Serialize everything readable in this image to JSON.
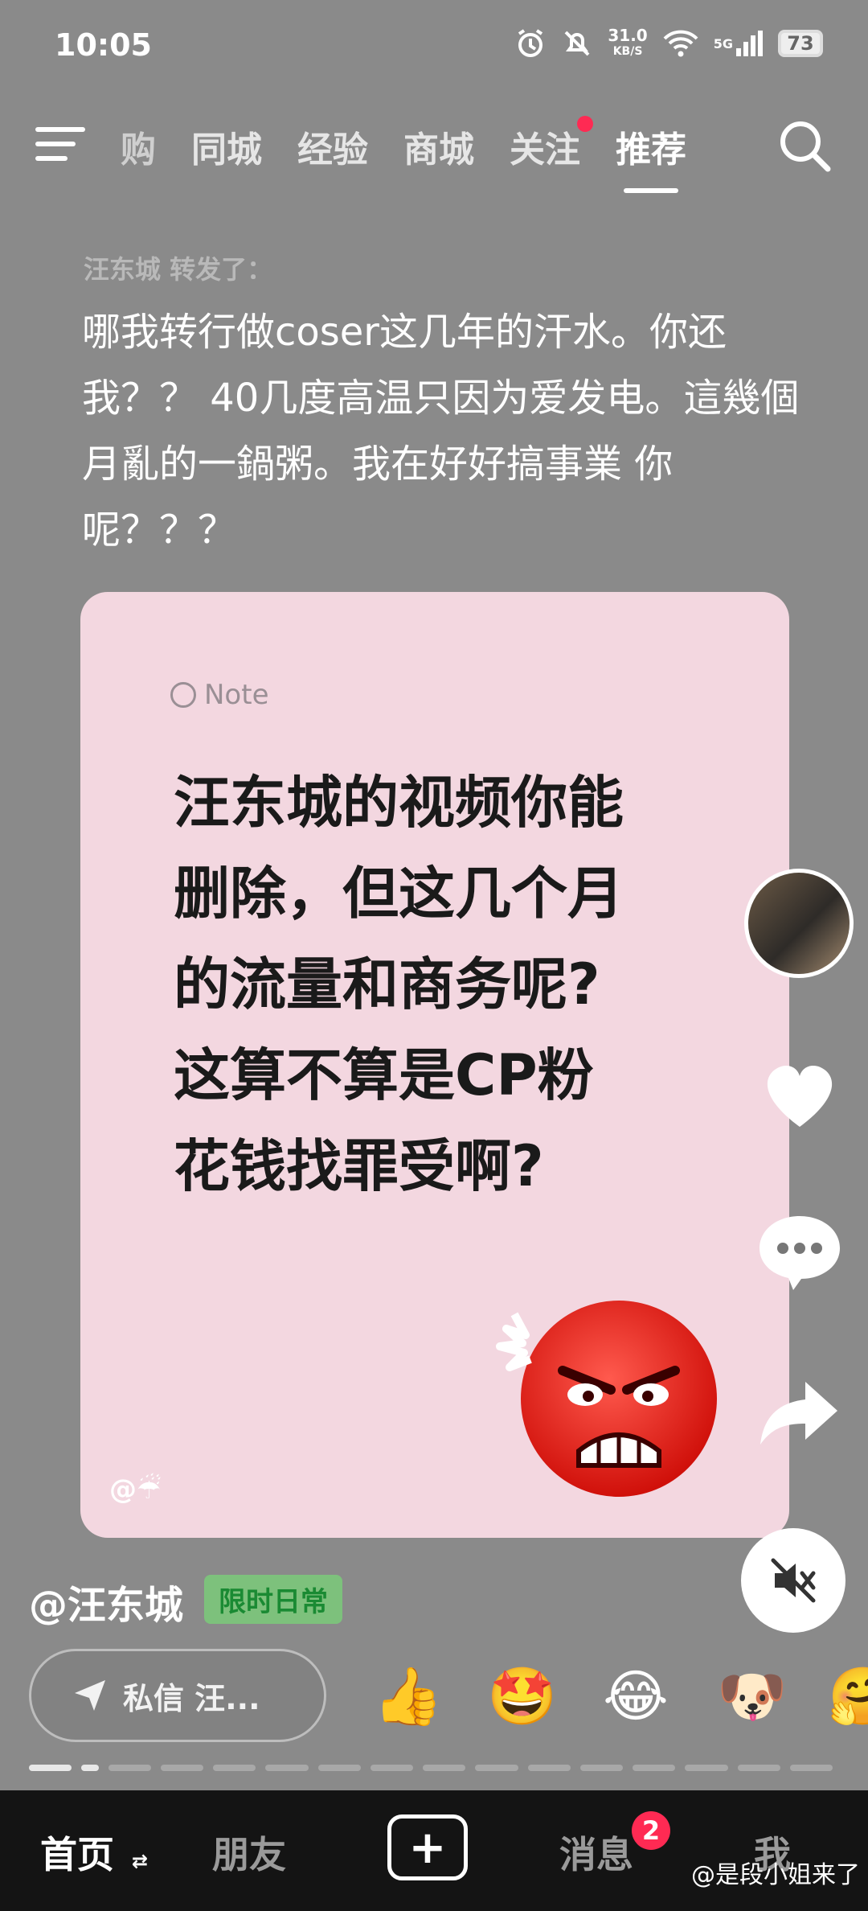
{
  "status_bar": {
    "time": "10:05",
    "net_speed": "31.0",
    "net_unit": "KB/S",
    "signal": "5G",
    "battery": "73"
  },
  "nav": {
    "tabs": [
      "购",
      "同城",
      "经验",
      "商城",
      "关注",
      "推荐"
    ],
    "active_tab": "推荐"
  },
  "post": {
    "repost_line": "汪东城 转发了：",
    "caption": "哪我转行做coser这几年的汗水。你还我？？ 40几度高温只因为爱发电。這幾個月亂的一鍋粥。我在好好搞事業 你呢？？？",
    "card": {
      "note_label": "Note",
      "text_lines": [
        "汪东城的视频你能",
        "删除，但这几个月",
        "的流量和商务呢?",
        "这算不算是CP粉",
        "花钱找罪受啊?"
      ],
      "watermark": "@☔"
    },
    "author": "@汪东城",
    "tag": "限时日常"
  },
  "dm": {
    "label": "私信 汪..."
  },
  "reactions": [
    "👍",
    "🤩",
    "😂",
    "🐶",
    "🤗"
  ],
  "bottom_nav": {
    "home": "首页",
    "friends": "朋友",
    "messages": "消息",
    "messages_badge": "2",
    "me": "我"
  },
  "weibo_watermark": "@是段小姐来了"
}
